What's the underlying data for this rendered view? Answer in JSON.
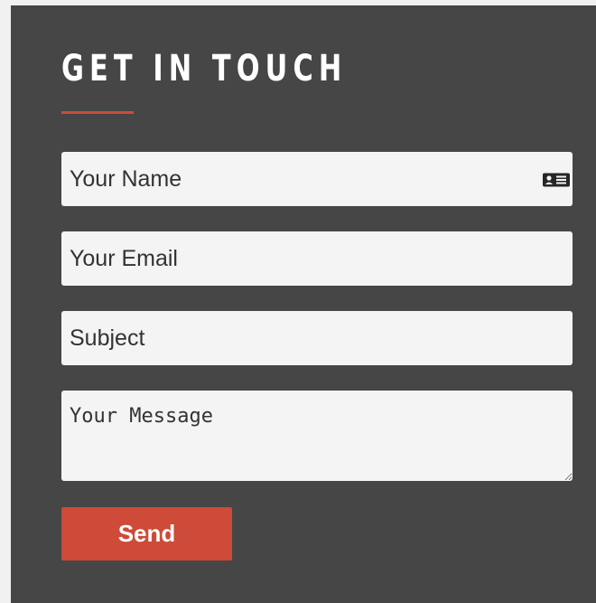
{
  "contact_form": {
    "heading": "GET IN TOUCH",
    "name_placeholder": "Your Name",
    "email_placeholder": "Your Email",
    "subject_placeholder": "Subject",
    "message_placeholder": "Your Message",
    "send_label": "Send",
    "name_field_icon": "contact-card-icon"
  },
  "colors": {
    "panel_background": "#464646",
    "page_background": "#f1f1f1",
    "accent": "#cd4b38",
    "field_background": "#f4f4f4",
    "heading_text": "#ffffff",
    "field_text": "#333333"
  }
}
